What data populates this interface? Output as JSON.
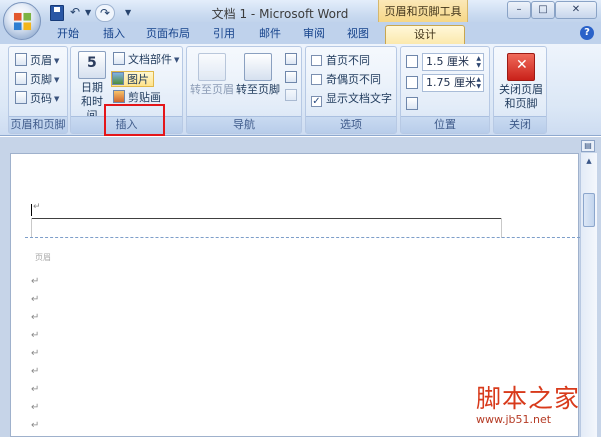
{
  "window": {
    "title": "文档 1 - Microsoft Word",
    "contextual_group": "页眉和页脚工具",
    "controls": {
      "minimize": "–",
      "maximize": "□",
      "close": "✕"
    }
  },
  "qat": {
    "undo": "↶",
    "redo": "↷",
    "dropdown": "▼"
  },
  "tabs": {
    "start": "开始",
    "insert": "插入",
    "layout": "页面布局",
    "references": "引用",
    "mailings": "邮件",
    "review": "审阅",
    "view": "视图",
    "design": "设计",
    "help": "?"
  },
  "ribbon": {
    "header_footer": {
      "label": "页眉和页脚",
      "header": "页眉",
      "footer": "页脚",
      "page_number": "页码"
    },
    "insert": {
      "label": "插入",
      "date_time": "日期和时间",
      "doc_parts": "文档部件",
      "picture": "图片",
      "clip_art": "剪贴画"
    },
    "navigation": {
      "label": "导航",
      "goto_header": "转至页眉",
      "goto_footer": "转至页脚"
    },
    "options": {
      "label": "选项",
      "different_first": "首页不同",
      "different_odd_even": "奇偶页不同",
      "show_doc_text": "显示文档文字",
      "show_doc_text_checked": "✓"
    },
    "position": {
      "label": "位置",
      "header_pos": "1.5 厘米",
      "footer_pos": "1.75 厘米"
    },
    "close": {
      "label": "关闭",
      "close_hf": "关闭页眉和页脚"
    }
  },
  "document": {
    "header_mark": "↵",
    "header_label": "页眉",
    "paragraph_mark": "↵"
  },
  "watermark": {
    "cn": "脚本之家",
    "url": "www.jb51.net"
  }
}
